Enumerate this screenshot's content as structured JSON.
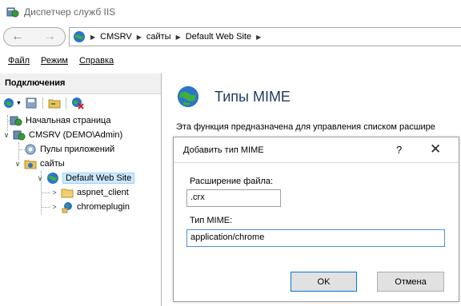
{
  "window": {
    "title": "Диспетчер служб IIS",
    "icon": "iis-manager-icon"
  },
  "addressbar": {
    "back_icon": "back-arrow-icon",
    "forward_icon": "forward-arrow-icon",
    "breadcrumbs": [
      "CMSRV",
      "сайты",
      "Default Web Site"
    ]
  },
  "menu": {
    "items": [
      "Файл",
      "Режим",
      "Справка"
    ]
  },
  "connections": {
    "header": "Подключения",
    "toolbar_icons": [
      "connect-icon",
      "save-icon",
      "folder-icon",
      "disconnect-icon"
    ],
    "tree": [
      {
        "label": "Начальная страница",
        "icon": "start-page-icon"
      },
      {
        "label": "CMSRV (DEMO\\Admin)",
        "icon": "server-icon"
      },
      {
        "label": "Пулы приложений",
        "icon": "app-pools-icon"
      },
      {
        "label": "сайты",
        "icon": "sites-folder-icon"
      },
      {
        "label": "Default Web Site",
        "icon": "globe-icon",
        "selected": true
      },
      {
        "label": "aspnet_client",
        "icon": "folder-icon"
      },
      {
        "label": "chromeplugin",
        "icon": "application-icon"
      }
    ]
  },
  "feature": {
    "title": "Типы MIME",
    "icon": "globe-icon",
    "description": "Эта функция предназначена для управления списком расшире"
  },
  "dialog": {
    "title": "Добавить тип MIME",
    "help": "?",
    "close": "✕",
    "extension_label": "Расширение файла:",
    "extension_value": ".crx",
    "mime_label": "Тип MIME:",
    "mime_value": "application/chrome",
    "ok_label": "OK",
    "cancel_label": "Отмена"
  },
  "colors": {
    "selection": "#cde8ff",
    "focus_border": "#4a90d9",
    "title_blue": "#1e3a5f"
  }
}
